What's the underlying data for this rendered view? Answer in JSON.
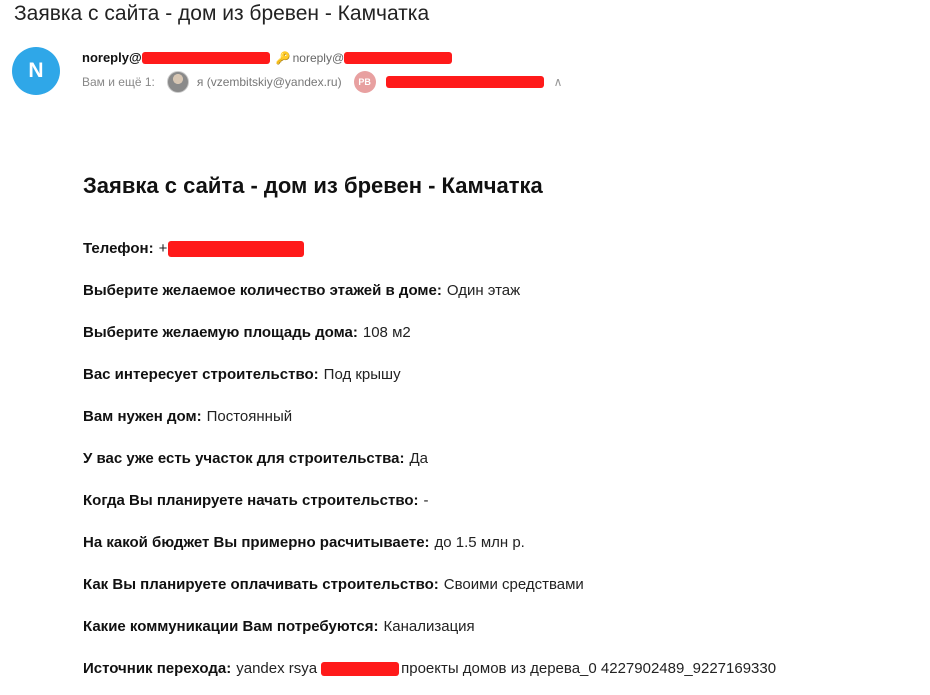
{
  "email": {
    "subject": "Заявка с сайта - дом из бревен - Камчатка",
    "sender": {
      "avatar_letter": "N",
      "name_prefix": "noreply@",
      "email_prefix": "noreply@"
    },
    "recipients": {
      "label": "Вам и ещё 1:",
      "me": "я (vzembitskiy@yandex.ru)",
      "other_initials": "РВ"
    },
    "body": {
      "title": "Заявка с сайта - дом из бревен - Камчатка",
      "fields": [
        {
          "label": "Телефон:",
          "value": "+"
        },
        {
          "label": "Выберите желаемое количество этажей в доме:",
          "value": "Один этаж"
        },
        {
          "label": "Выберите желаемую площадь дома:",
          "value": "108 м2"
        },
        {
          "label": "Вас интересует строительство:",
          "value": "Под крышу"
        },
        {
          "label": "Вам нужен дом:",
          "value": "Постоянный"
        },
        {
          "label": "У вас уже есть участок для строительства:",
          "value": "Да"
        },
        {
          "label": "Когда Вы планируете начать строительство:",
          "value": "-"
        },
        {
          "label": "На какой бюджет Вы примерно расчитываете:",
          "value": "до 1.5 млн р."
        },
        {
          "label": "Как Вы планируете оплачивать строительство:",
          "value": "Своими средствами"
        },
        {
          "label": "Какие коммуникации Вам потребуются:",
          "value": "Канализация"
        },
        {
          "label": "Источник перехода:",
          "value": "yandex rsya",
          "value_suffix": "проекты домов из дерева_0 4227902489_9227169330"
        }
      ]
    },
    "icons": {
      "key": "key-icon",
      "expand": "chevron-up-icon"
    },
    "colors": {
      "avatar": "#2fa7e8",
      "redaction": "#ff1a1a"
    }
  }
}
